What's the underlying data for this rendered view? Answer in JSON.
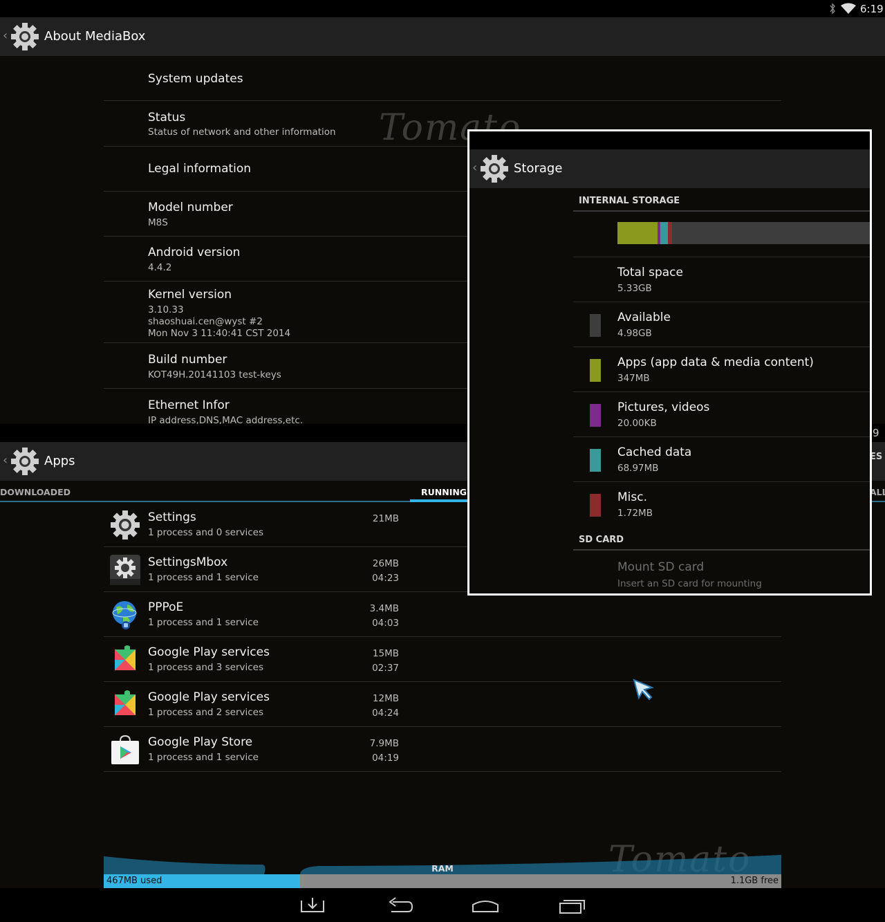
{
  "status_bar": {
    "time": "6:19",
    "icons": [
      "bluetooth-icon",
      "wifi-icon"
    ]
  },
  "about": {
    "title": "About MediaBox",
    "items": [
      {
        "title": "System updates",
        "summary": []
      },
      {
        "title": "Status",
        "summary": [
          "Status of network and other information"
        ]
      },
      {
        "title": "Legal information",
        "summary": []
      },
      {
        "title": "Model number",
        "summary": [
          "M8S"
        ]
      },
      {
        "title": "Android version",
        "summary": [
          "4.4.2"
        ]
      },
      {
        "title": "Kernel version",
        "summary": [
          "3.10.33",
          "shaoshuai.cen@wyst #2",
          "Mon Nov 3 11:40:41 CST 2014"
        ]
      },
      {
        "title": "Build number",
        "summary": [
          "KOT49H.20141103 test-keys"
        ]
      },
      {
        "title": "Ethernet Infor",
        "summary": [
          "IP address,DNS,MAC address,etc."
        ]
      }
    ]
  },
  "apps": {
    "title": "Apps",
    "tabs": {
      "downloaded": "DOWNLOADED",
      "running": "RUNNING",
      "all_partial": "ALL"
    },
    "partial_right": {
      "count_fragment": "9",
      "label_fragment": "ES"
    },
    "rows": [
      {
        "name": "Settings",
        "detail": "1 process and 0 services",
        "size": "21MB",
        "time": "",
        "icon": "settings-gear-icon"
      },
      {
        "name": "SettingsMbox",
        "detail": "1 process and 1 service",
        "size": "26MB",
        "time": "04:23",
        "icon": "settings-mbox-icon"
      },
      {
        "name": "PPPoE",
        "detail": "1 process and 1 service",
        "size": "3.4MB",
        "time": "04:03",
        "icon": "globe-network-icon"
      },
      {
        "name": "Google Play services",
        "detail": "1 process and 3 services",
        "size": "15MB",
        "time": "02:37",
        "icon": "puzzle-icon"
      },
      {
        "name": "Google Play services",
        "detail": "1 process and 2 services",
        "size": "12MB",
        "time": "04:24",
        "icon": "puzzle-icon"
      },
      {
        "name": "Google Play Store",
        "detail": "1 process and 1 service",
        "size": "7.9MB",
        "time": "04:19",
        "icon": "play-store-icon"
      }
    ],
    "ram": {
      "label": "RAM",
      "used": "467MB used",
      "free": "1.1GB free",
      "used_fraction": 0.29
    }
  },
  "storage": {
    "title": "Storage",
    "internal_header": "INTERNAL STORAGE",
    "usage_segments": [
      {
        "color": "#8a9a1e",
        "fraction": 0.155
      },
      {
        "color": "#7b2c8a",
        "fraction": 0.012
      },
      {
        "color": "#3a9a9a",
        "fraction": 0.03
      },
      {
        "color": "#8b2c2c",
        "fraction": 0.016
      }
    ],
    "items": [
      {
        "title": "Total space",
        "value": "5.33GB",
        "color": ""
      },
      {
        "title": "Available",
        "value": "4.98GB",
        "color": "#3d3d3d"
      },
      {
        "title": "Apps (app data & media content)",
        "value": "347MB",
        "color": "#8a9a1e"
      },
      {
        "title": "Pictures, videos",
        "value": "20.00KB",
        "color": "#7b2c8a"
      },
      {
        "title": "Cached data",
        "value": "68.97MB",
        "color": "#3a9a9a"
      },
      {
        "title": "Misc.",
        "value": "1.72MB",
        "color": "#8b2c2c"
      }
    ],
    "sd_header": "SD CARD",
    "sd_item": {
      "title": "Mount SD card",
      "summary": "Insert an SD card for mounting"
    }
  },
  "nav": {
    "icons": [
      "download-icon",
      "back-icon",
      "home-icon",
      "recents-icon"
    ]
  },
  "watermark": "Tomato"
}
